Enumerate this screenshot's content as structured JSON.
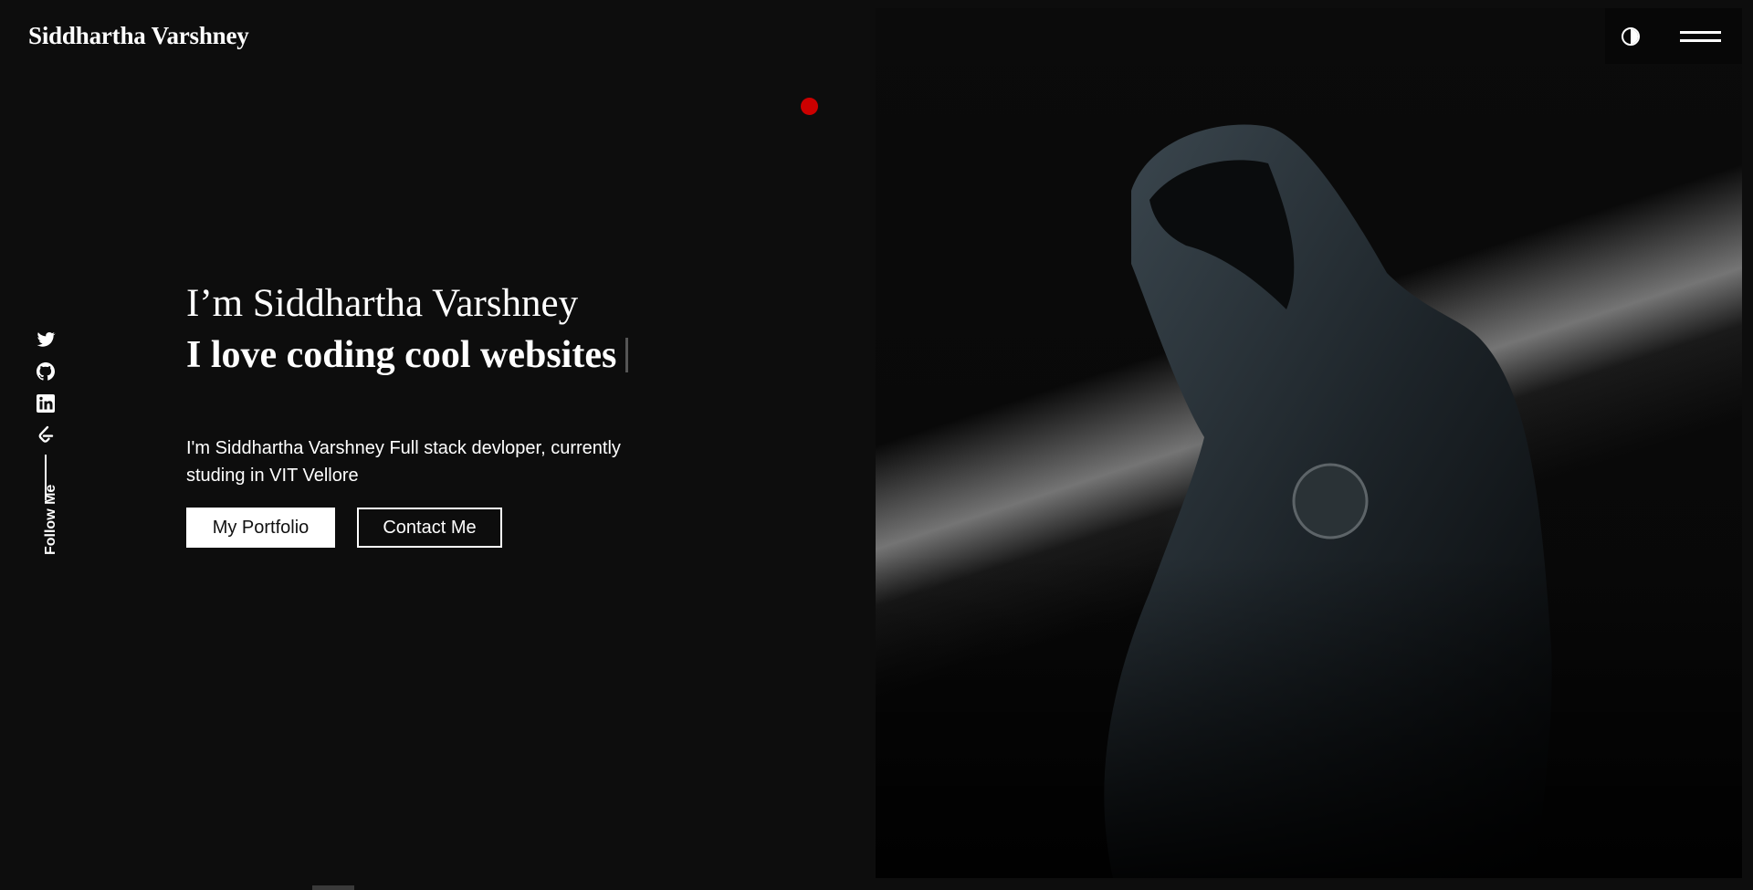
{
  "header": {
    "brand": "Siddhartha Varshney",
    "theme_toggle_icon": "half-circle-contrast-icon",
    "menu_icon": "hamburger-menu-icon"
  },
  "social": {
    "items": [
      {
        "icon": "twitter-icon"
      },
      {
        "icon": "github-icon"
      },
      {
        "icon": "linkedin-icon"
      },
      {
        "icon": "leetcode-icon"
      }
    ],
    "follow_label": "Follow Me"
  },
  "intro": {
    "name_line": "I’m Siddhartha Varshney",
    "tagline": "I love coding cool websites",
    "description": "I'm Siddhartha Varshney Full stack devloper, currently studing in VIT Vellore"
  },
  "buttons": {
    "portfolio": "My Portfolio",
    "contact": "Contact Me"
  },
  "colors": {
    "background": "#0d0d0d",
    "accent_dot": "#cc0000",
    "text": "#ffffff"
  }
}
